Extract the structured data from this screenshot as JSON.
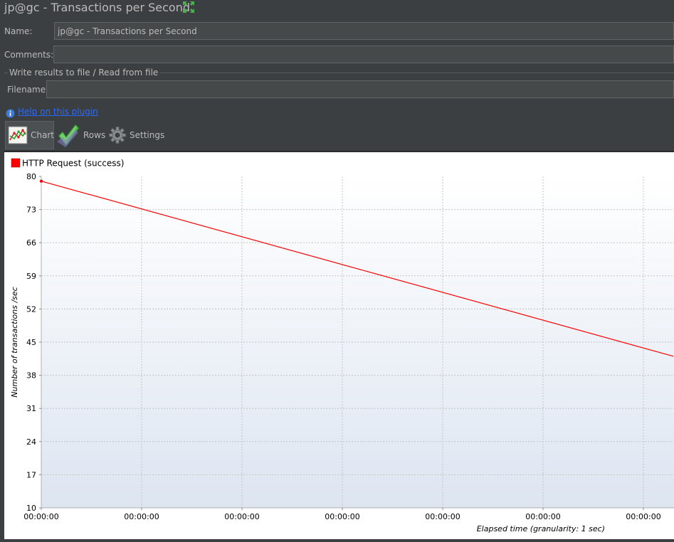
{
  "window": {
    "title": "jp@gc - Transactions per Second"
  },
  "form": {
    "name_label": "Name:",
    "name_value": "jp@gc - Transactions per Second",
    "comments_label": "Comments:",
    "comments_value": "",
    "file_section_label": "Write results to file / Read from file",
    "filename_label": "Filename",
    "filename_value": ""
  },
  "help": {
    "link_text": "Help on this plugin"
  },
  "tabs": [
    {
      "label": "Chart",
      "icon": "chart-icon",
      "active": true
    },
    {
      "label": "Rows",
      "icon": "checkmark-icon",
      "active": false
    },
    {
      "label": "Settings",
      "icon": "gear-icon",
      "active": false
    }
  ],
  "colors": {
    "series": "#ff0000",
    "background": "#3c3f41",
    "link": "#2a6bff"
  },
  "chart_data": {
    "type": "line",
    "title": "",
    "xlabel": "Elapsed time (granularity: 1 sec)",
    "ylabel": "Number of transactions /sec",
    "ylim": [
      10,
      80
    ],
    "y_ticks": [
      "80",
      "73",
      "66",
      "59",
      "52",
      "45",
      "38",
      "31",
      "24",
      "17",
      "10"
    ],
    "x_ticks": [
      "00:00:00",
      "00:00:00",
      "00:00:00",
      "00:00:00",
      "00:00:00",
      "00:00:00",
      "00:00:00"
    ],
    "legend": "top-left",
    "grid": true,
    "series": [
      {
        "name": "HTTP Request (success)",
        "x": [
          0,
          6.3
        ],
        "values": [
          79,
          42
        ]
      }
    ]
  }
}
